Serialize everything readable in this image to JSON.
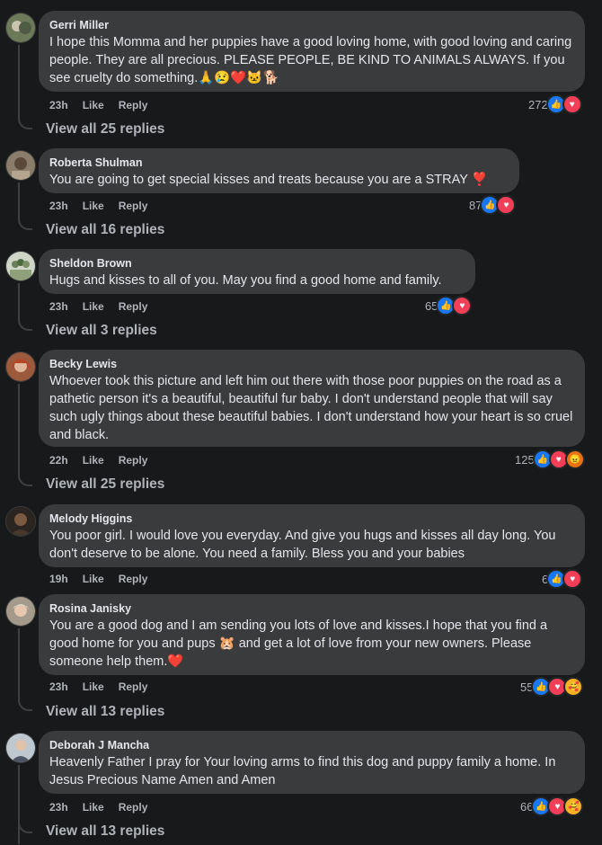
{
  "comments": [
    {
      "author": "Gerri Miller",
      "text": "I hope this Momma and her puppies have a good loving home, with good loving and caring people. They are all precious. PLEASE PEOPLE, BE KIND TO ANIMALS ALWAYS. If you see cruelty do something.🙏😢❤️🐱🐕",
      "time": "23h",
      "like": "Like",
      "reply": "Reply",
      "reaction_count": "272",
      "reactions": [
        "like-icon",
        "love-icon"
      ],
      "view_replies": "View all 25 replies"
    },
    {
      "author": "Roberta Shulman",
      "text": "You are going to get special kisses and treats because you are a STRAY ❣️",
      "time": "23h",
      "like": "Like",
      "reply": "Reply",
      "reaction_count": "87",
      "reactions": [
        "like-icon",
        "love-icon"
      ],
      "view_replies": "View all 16 replies"
    },
    {
      "author": "Sheldon Brown",
      "text": "Hugs and kisses to all of you. May you find a good home and family.",
      "time": "23h",
      "like": "Like",
      "reply": "Reply",
      "reaction_count": "65",
      "reactions": [
        "like-icon",
        "love-icon"
      ],
      "view_replies": "View all 3 replies"
    },
    {
      "author": "Becky Lewis",
      "text": "Whoever took this picture and left him out there with those poor puppies on the road as a pathetic person it's a beautiful, beautiful fur baby. I don't understand people that will say such ugly things about these beautiful babies. I don't understand how your heart is so cruel and black.",
      "time": "22h",
      "like": "Like",
      "reply": "Reply",
      "reaction_count": "125",
      "reactions": [
        "like-icon",
        "love-icon",
        "angry-icon"
      ],
      "view_replies": "View all 25 replies"
    },
    {
      "author": "Melody Higgins",
      "text": "You poor girl. I would love you everyday. And give you hugs and kisses all day long. You don't deserve to be alone. You need a family. Bless you and your babies",
      "time": "19h",
      "like": "Like",
      "reply": "Reply",
      "reaction_count": "6",
      "reactions": [
        "like-icon",
        "love-icon"
      ],
      "view_replies": ""
    },
    {
      "author": "Rosina Janisky",
      "text": "You are a good dog and I am sending you lots of love and kisses.I hope that you find a good home for you and pups 🐹 and get a lot of love from your new owners. Please someone help them.❤️",
      "time": "23h",
      "like": "Like",
      "reply": "Reply",
      "reaction_count": "55",
      "reactions": [
        "like-icon",
        "love-icon",
        "care-icon"
      ],
      "view_replies": "View all 13 replies"
    },
    {
      "author": "Deborah J Mancha",
      "text": "Heavenly Father I pray for Your loving arms to find this dog and puppy family a home. In Jesus Precious Name Amen and Amen",
      "time": "23h",
      "like": "Like",
      "reply": "Reply",
      "reaction_count": "66",
      "reactions": [
        "like-icon",
        "love-icon",
        "care-icon"
      ],
      "view_replies": "View all 13 replies"
    }
  ],
  "colors": {
    "background": "#18191a",
    "bubble": "#3a3b3c",
    "text": "#e4e6eb",
    "muted": "#b0b3b8",
    "like": "#1877f2",
    "love": "#f33e58"
  }
}
